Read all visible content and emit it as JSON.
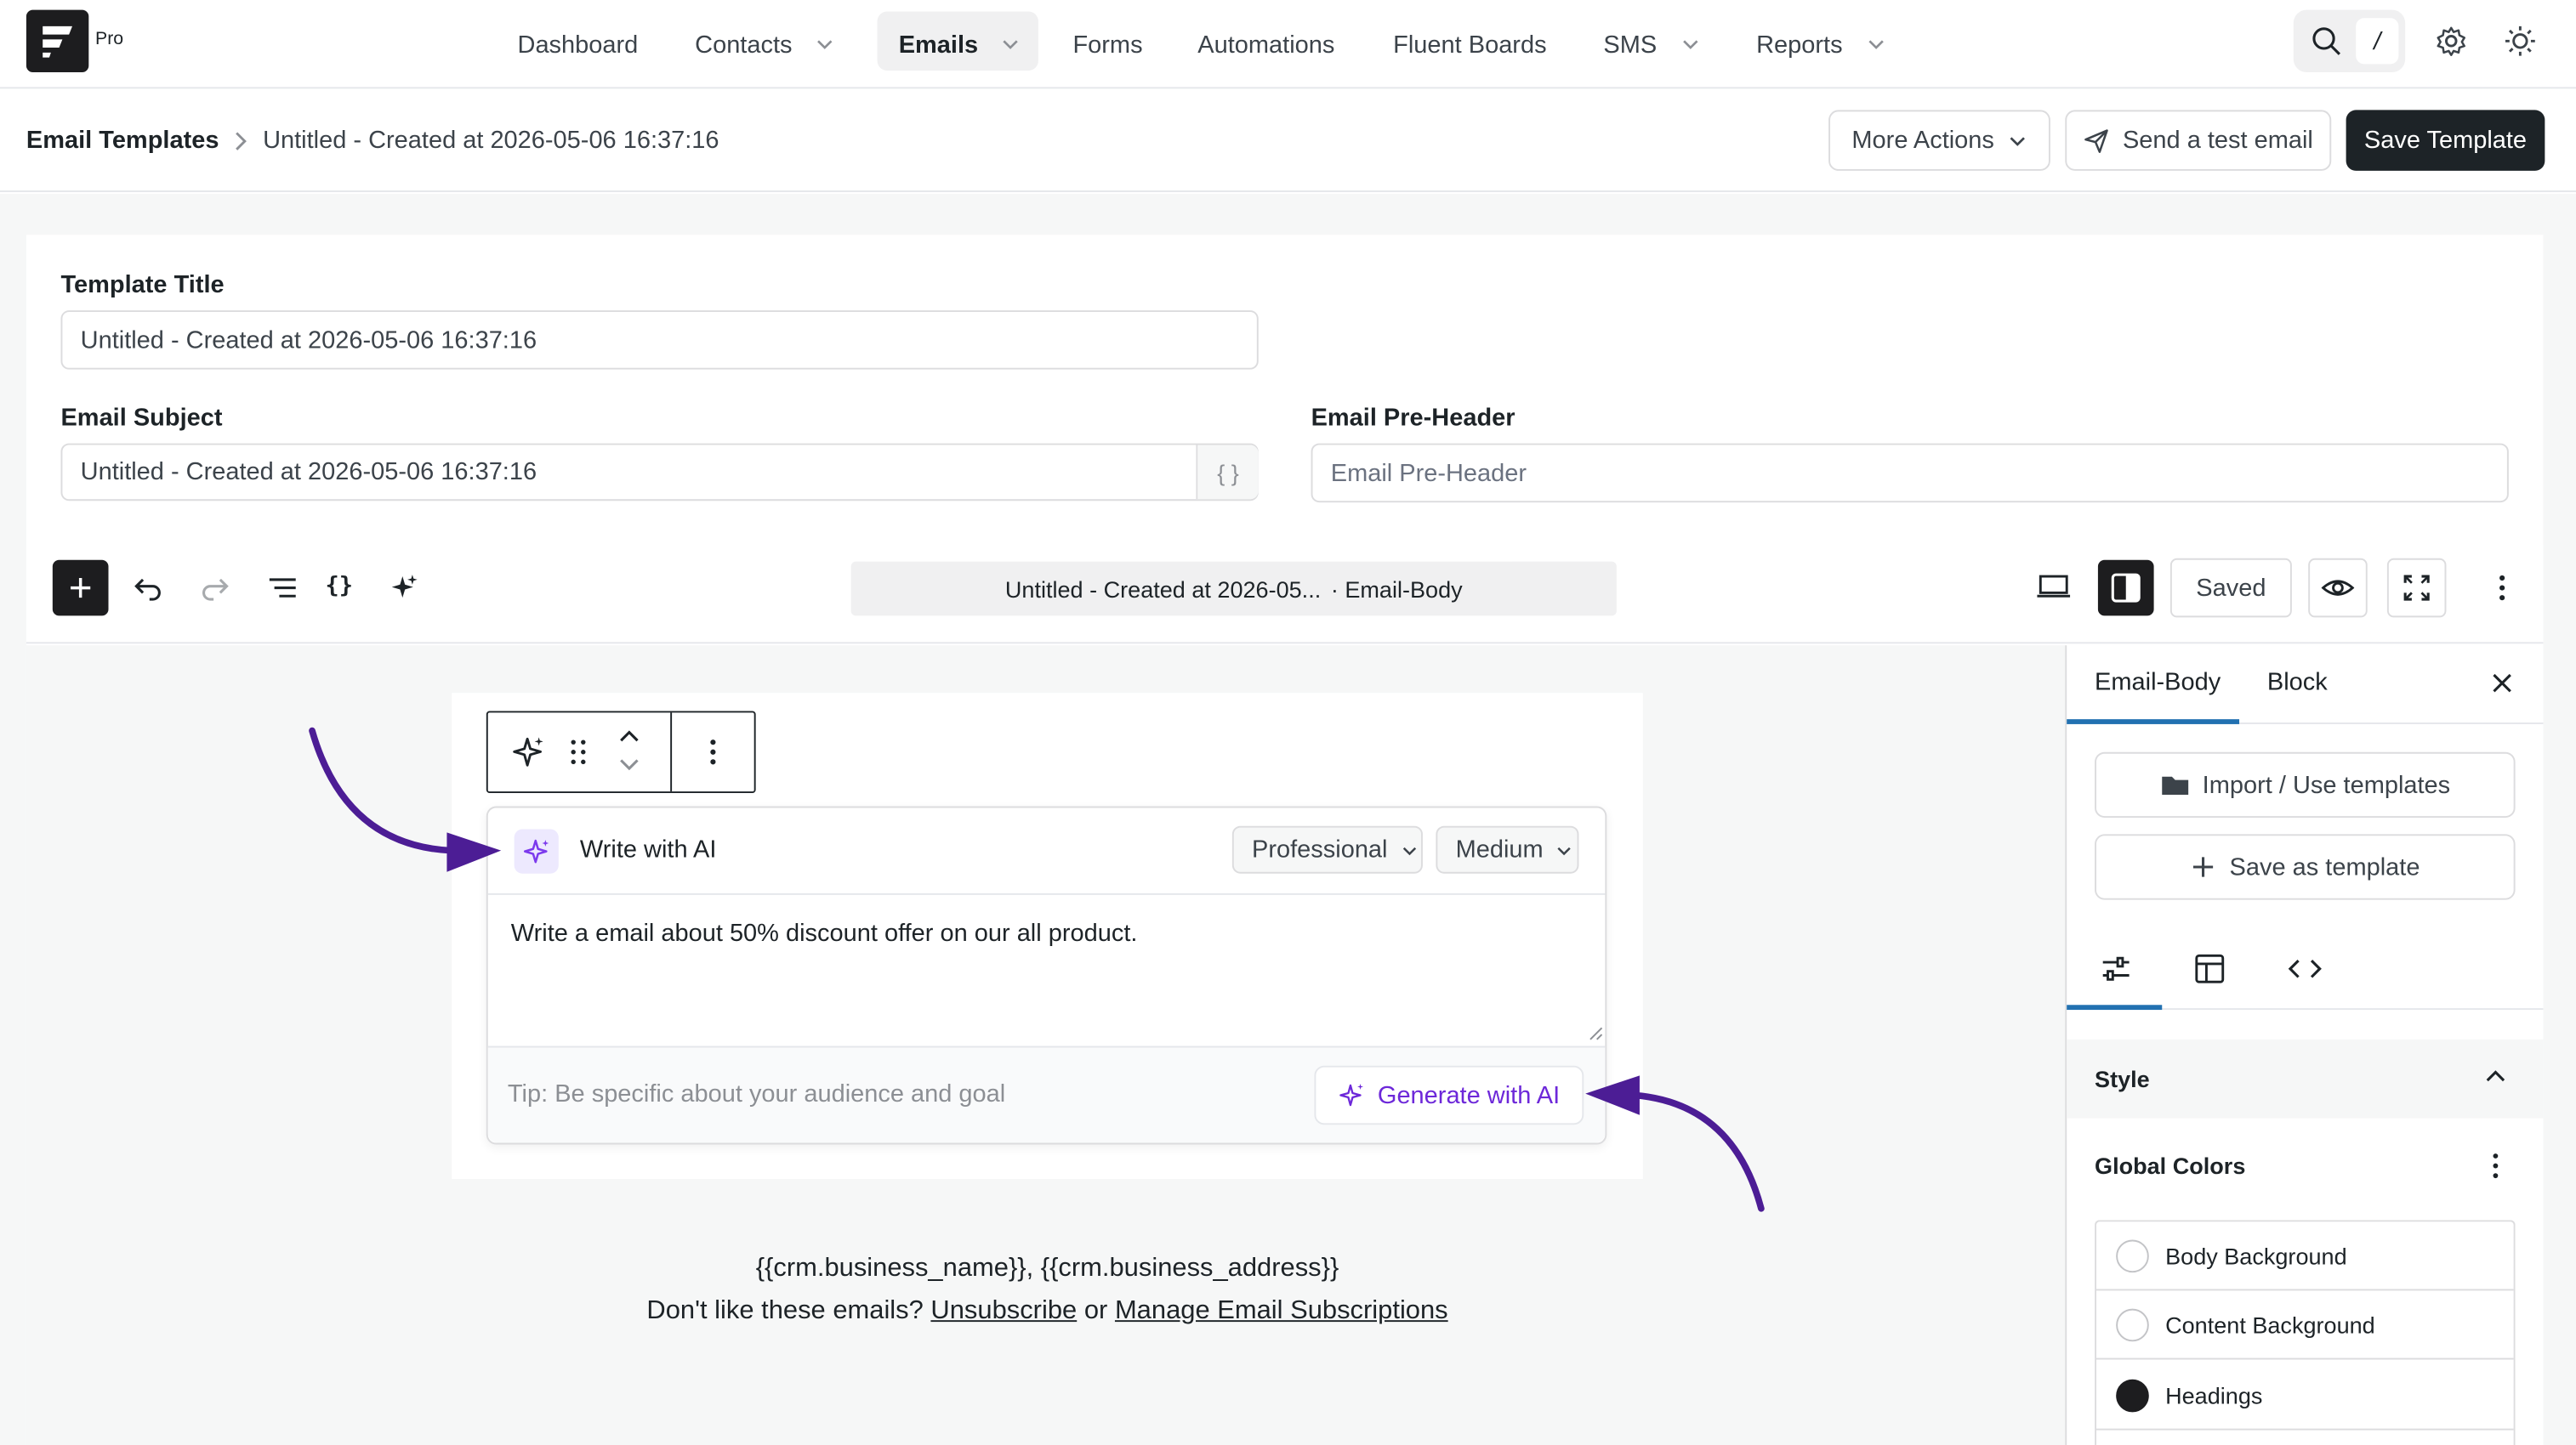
{
  "brand": {
    "badge": "Pro"
  },
  "nav": {
    "items": [
      {
        "label": "Dashboard"
      },
      {
        "label": "Contacts"
      },
      {
        "label": "Emails"
      },
      {
        "label": "Forms"
      },
      {
        "label": "Automations"
      },
      {
        "label": "Fluent Boards"
      },
      {
        "label": "SMS"
      },
      {
        "label": "Reports"
      }
    ],
    "search_shortcut": "/"
  },
  "header": {
    "breadcrumb_root": "Email Templates",
    "breadcrumb_current": "Untitled - Created at 2026-05-06 16:37:16",
    "more_actions": "More Actions",
    "send_test": "Send a test email",
    "save": "Save Template"
  },
  "form": {
    "title_label": "Template Title",
    "title_value": "Untitled - Created at 2026-05-06 16:37:16",
    "subject_label": "Email Subject",
    "subject_value": "Untitled - Created at 2026-05-06 16:37:16",
    "subject_shortcode": "{ }",
    "preheader_label": "Email Pre-Header",
    "preheader_placeholder": "Email Pre-Header"
  },
  "editor": {
    "doc_title": "Untitled - Created at 2026-05...",
    "doc_section": "· Email-Body",
    "saved_label": "Saved"
  },
  "ai": {
    "title": "Write with AI",
    "tone": "Professional",
    "length": "Medium",
    "prompt": "Write a email about 50% discount offer on our all product.",
    "tip": "Tip: Be specific about your audience and goal",
    "generate": "Generate with AI"
  },
  "footer": {
    "shortcodes": "{{crm.business_name}}, {{crm.business_address}}",
    "prefix": "Don't like these emails?",
    "unsubscribe": "Unsubscribe",
    "or": "or",
    "manage": "Manage Email Subscriptions"
  },
  "sidebar": {
    "tab_body": "Email-Body",
    "tab_block": "Block",
    "import_label": "Import / Use templates",
    "save_as_label": "Save as template",
    "style_title": "Style",
    "global_colors": "Global Colors",
    "colors": [
      {
        "label": "Body Background",
        "color": "#ffffff"
      },
      {
        "label": "Content Background",
        "color": "#ffffff"
      },
      {
        "label": "Headings",
        "color": "#1d1d1f"
      }
    ]
  },
  "accent": {
    "ai_purple": "#6d28d9",
    "arrow": "#4c1d95",
    "dark": "#1d2327"
  }
}
